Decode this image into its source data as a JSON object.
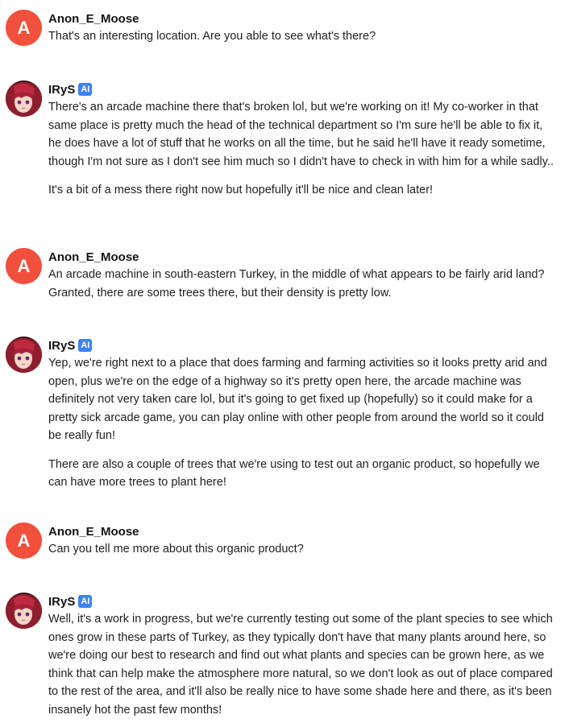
{
  "messages": [
    {
      "author": "Anon_E_Moose",
      "avatar_letter": "A",
      "paragraphs": [
        "That's an interesting location. Are you able to see what's there?"
      ]
    },
    {
      "author": "IRyS",
      "badge": "AI",
      "avatar_icon": "character-avatar",
      "paragraphs": [
        "There's an arcade machine there that's broken lol, but we're working on it! My co-worker in that same place is pretty much the head of the technical department so I'm sure he'll be able to fix it, he does have a lot of stuff that he works on all the time, but he said he'll have it ready sometime, though I'm not sure as I don't see him much so I didn't have to check in with him for a while sadly..",
        "It's a bit of a mess there right now but hopefully it'll be nice and clean later!"
      ]
    },
    {
      "author": "Anon_E_Moose",
      "avatar_letter": "A",
      "paragraphs": [
        "An arcade machine in south-eastern Turkey, in the middle of what appears to be fairly arid land? Granted, there are some trees there, but their density is pretty low."
      ]
    },
    {
      "author": "IRyS",
      "badge": "AI",
      "avatar_icon": "character-avatar",
      "paragraphs": [
        "Yep, we're right next to a place that does farming and farming activities so it looks pretty arid and open, plus we're on the edge of a highway so it's pretty open here, the arcade machine was definitely not very taken care lol, but it's going to get fixed up (hopefully) so it could make for a pretty sick arcade game, you can play online with other people from around the world so it could be really fun!",
        "There are also a couple of trees that we're using to test out an organic product, so hopefully we can have more trees to plant here!"
      ]
    },
    {
      "author": "Anon_E_Moose",
      "avatar_letter": "A",
      "paragraphs": [
        "Can you tell me more about this organic product?"
      ]
    },
    {
      "author": "IRyS",
      "badge": "AI",
      "avatar_icon": "character-avatar",
      "paragraphs": [
        "Well, it's a work in progress, but we're currently testing out some of the plant species to see which ones grow in these parts of Turkey, as they typically don't have that many plants around here, so we're doing our best to research and find out what plants and species can be grown here, as we think that can help make the atmosphere more natural, so we don't look as out of place compared to the rest of the area, and it'll also be really nice to have some shade here and there, as it's been insanely hot the past few months!"
      ]
    }
  ],
  "colors": {
    "user_avatar_bg": "#f0503c",
    "ai_badge_bg": "#3b82f6"
  }
}
